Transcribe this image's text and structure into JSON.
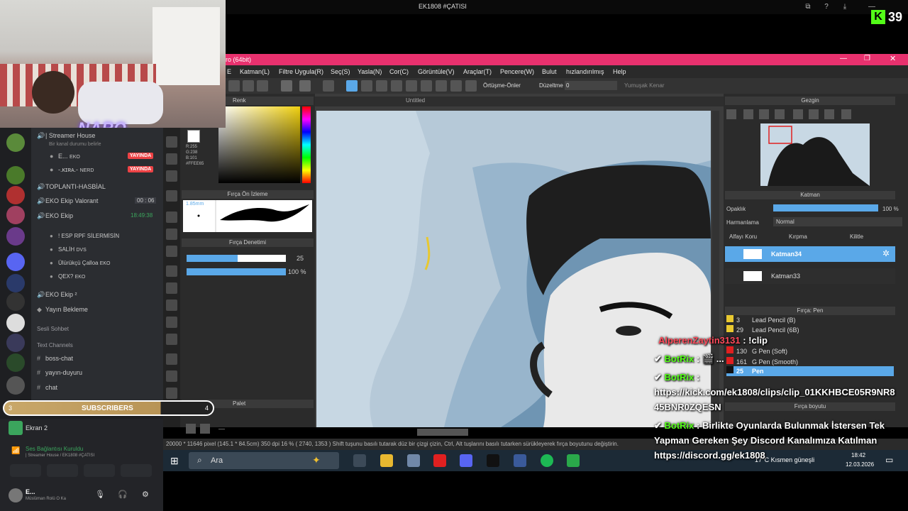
{
  "stream": {
    "title": "EK1808 #ÇATISI",
    "viewers": "39",
    "kick": "K"
  },
  "webcam": {
    "logo": "NARO"
  },
  "discord": {
    "stream_channel": "| Streamer House",
    "stream_status": "Bir kanal durumu belirle",
    "users_live": [
      {
        "name": "E...",
        "tag": "EKO",
        "badge": "YAYINDA"
      },
      {
        "name": "-.ᴋɪʀᴀ.-",
        "tag": "NERD",
        "badge": "YAYINDA"
      }
    ],
    "channels": [
      {
        "name": "TOPLANTI-HASBİAL"
      },
      {
        "name": "EKO Ekip Valorant",
        "info": "00 : 06"
      },
      {
        "name": "EKO Ekip",
        "info": "18:49:38"
      }
    ],
    "members": [
      {
        "name": "! ESP RPF SİLERMİSİN"
      },
      {
        "name": "SALİH",
        "tag": "DVS"
      },
      {
        "name": "Ülürükçü Çalloa",
        "tag": "EKO"
      },
      {
        "name": "QEX?",
        "tag": "EKO"
      }
    ],
    "channels2": [
      {
        "name": "EKO Ekip ²"
      },
      {
        "name": "Yayın Bekleme"
      }
    ],
    "voice_header": "Sesli Sohbet",
    "text_header": "Text Channels",
    "text_channels": [
      "boss-chat",
      "yayın-duyuru",
      "chat"
    ],
    "screen_share": "Ekran 2",
    "voice_status": "Ses Bağlantısı Kuruldu",
    "voice_sub": "| Streamer House / EK1808 #ÇATISI",
    "user": {
      "name": "E...",
      "status": "Müslüman Rolü O Ka"
    }
  },
  "subscribers": {
    "label": "SUBSCRIBERS",
    "current": "3",
    "goal": "4"
  },
  "clipstudio": {
    "title": "ro (64bit)",
    "menu": [
      "E",
      "Katman(L)",
      "Filtre Uygula(R)",
      "Seç(S)",
      "Yasla(N)",
      "Cor(C)",
      "Görüntüle(V)",
      "Araçlar(T)",
      "Pencere(W)",
      "Bulut",
      "hızlandırılmış",
      "Help"
    ],
    "toolbar_opt1": "Örtüşme-Önler",
    "toolbar_opt2": "Düzeltme",
    "toolbar_val": "0",
    "toolbar_opt3": "Yumuşak Kenar",
    "color_panel": "Renk",
    "color_info": "R:255\nG:238\nB:101\n#FFEE65",
    "brush_preview_panel": "Fırça Ön İzleme",
    "brush_size_label": "1.85mm",
    "brush_control_panel": "Fırça Denetimi",
    "size_val": "25",
    "opacity_val": "100 %",
    "palette_panel": "Palet",
    "palette_val": "—",
    "canvas_tab": "Untitled",
    "navigator_panel": "Gezgin",
    "layer_panel": "Katman",
    "opacity_label": "Opaklık",
    "opacity_pct": "100 %",
    "blend_label": "Harmanlama",
    "blend_val": "Normal",
    "check_alpha": "Alfayı Koru",
    "check_clip": "Kırpma",
    "check_lock": "Kilitle",
    "layers": [
      "Katman34",
      "Katman33"
    ],
    "brush_panel": "Fırça: Pen",
    "brushes": [
      {
        "num": "3",
        "name": "Lead Pencil (B)"
      },
      {
        "num": "29",
        "name": "Lead Pencil (6B)"
      },
      {
        "num": "130",
        "name": "G Pen (Soft)"
      },
      {
        "num": "161",
        "name": "G Pen (Smooth)"
      },
      {
        "num": "25",
        "name": "Pen"
      }
    ],
    "brush_size_panel": "Fırça boyutu",
    "status": "20000 * 11646 pixel   (145.1 * 84.5cm)   350 dpi   16 %   ( 2740, 1353 )   Shift tuşunu basılı tutarak düz bir çizgi çizin, Ctrl, Alt tuşlarını basılı tutarken sürükleyerek fırça boyutunu değiştirin."
  },
  "taskbar": {
    "search": "Ara",
    "weather": "17°C  Kısmen güneşli",
    "time": "18:42",
    "date": "12.03.2026"
  },
  "chat": [
    {
      "user": "AlperenZaytin3131",
      "msg": ": !clip"
    },
    {
      "user": "BotRix",
      "msg": ": 🎬 ..."
    },
    {
      "user": "BotRix",
      "msg": ":"
    },
    {
      "line": "https://kick.com/ek1808/clips/clip_01KKHBCE05R9NR8"
    },
    {
      "line": "45BNR0ZQESN"
    },
    {
      "user": "BotRix",
      "msg": ": Birlikte Oyunlarda Bulunmak İstersen Tek"
    },
    {
      "line": "Yapman Gereken Şey Discord Kanalımıza Katılman"
    },
    {
      "line": "https://discord.gg/ek1808"
    }
  ],
  "colors": {
    "kick": "#53fc18",
    "accent": "#e8316e",
    "live": "#ed4245",
    "selected": "#5aa8e8"
  }
}
